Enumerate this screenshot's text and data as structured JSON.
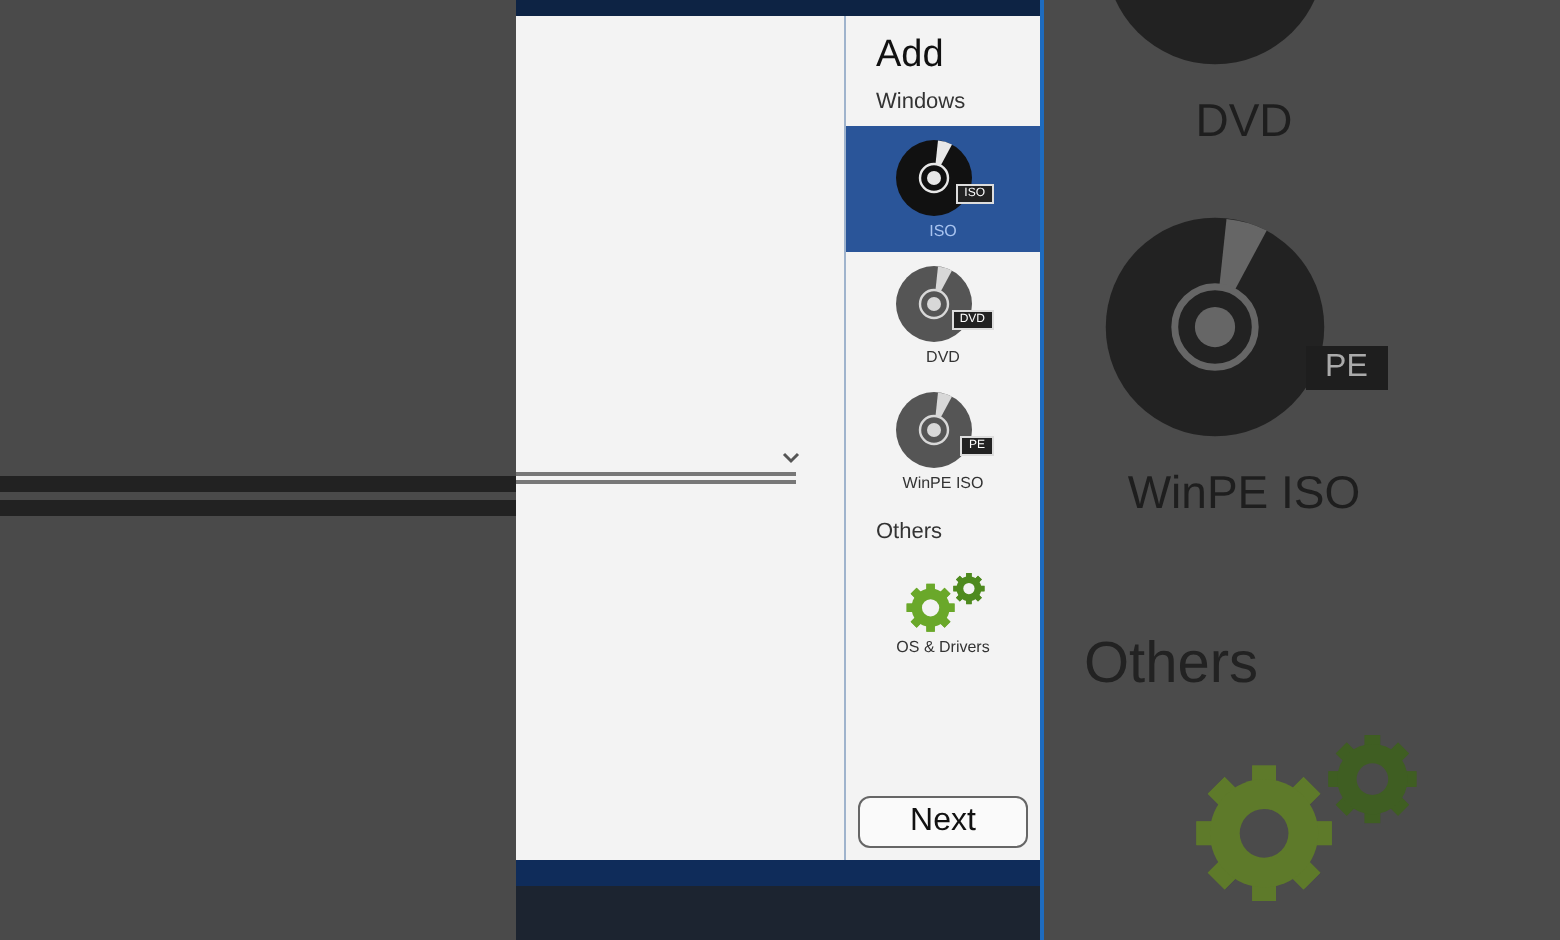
{
  "panel": {
    "title": "Add",
    "sections": [
      {
        "heading": "Windows",
        "items": [
          {
            "kind": "disc",
            "label": "ISO",
            "badge": "ISO",
            "selected": true
          },
          {
            "kind": "disc",
            "label": "DVD",
            "badge": "DVD",
            "selected": false
          },
          {
            "kind": "disc",
            "label": "WinPE ISO",
            "badge": "PE",
            "selected": false
          }
        ]
      },
      {
        "heading": "Others",
        "items": [
          {
            "kind": "gears",
            "label": "OS & Drivers",
            "selected": false
          }
        ]
      }
    ],
    "next_button": "Next"
  },
  "zoomed_backdrop": {
    "items": [
      {
        "label": "DVD"
      },
      {
        "label": "WinPE ISO",
        "badge": "PE"
      }
    ],
    "heading": "Others"
  }
}
